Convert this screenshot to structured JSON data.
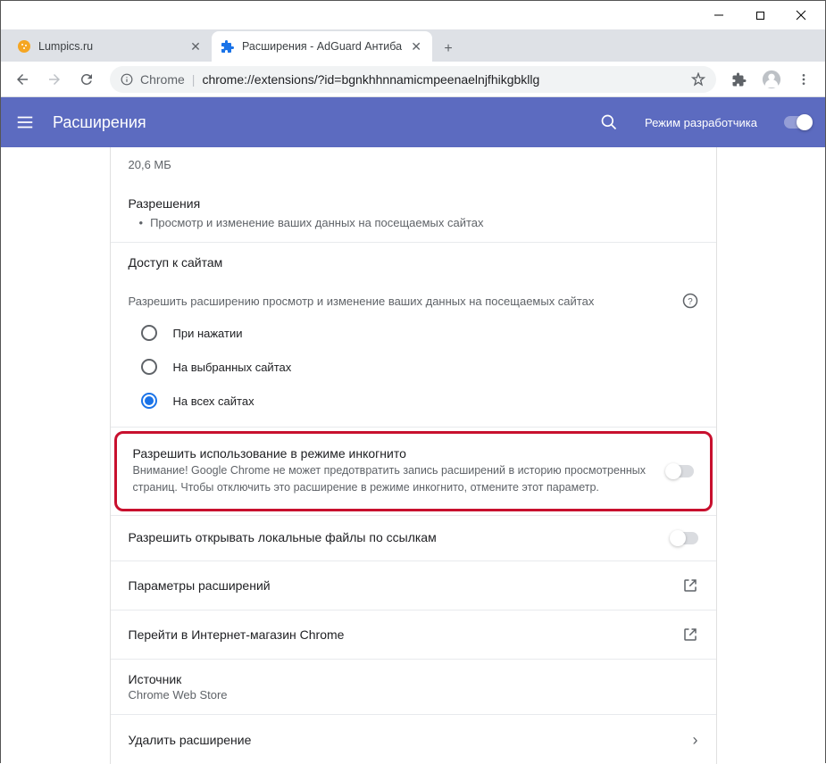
{
  "window": {
    "tabs": [
      {
        "title": "Lumpics.ru",
        "active": false
      },
      {
        "title": "Расширения - AdGuard Антиба",
        "active": true
      }
    ]
  },
  "addressbar": {
    "prefix": "Chrome",
    "url_prefix": "chrome://",
    "url_bold": "extensions",
    "url_rest": "/?id=bgnkhhnnamicmpeenaelnjfhikgbkllg"
  },
  "header": {
    "title": "Расширения",
    "devmode_label": "Режим разработчика"
  },
  "detail": {
    "size": "20,6 МБ",
    "permissions_title": "Разрешения",
    "permissions_item": "Просмотр и изменение ваших данных на посещаемых сайтах",
    "site_access_title": "Доступ к сайтам",
    "site_access_sub": "Разрешить расширению просмотр и изменение ваших данных на посещаемых сайтах",
    "radio_options": [
      "При нажатии",
      "На выбранных сайтах",
      "На всех сайтах"
    ],
    "radio_selected_index": 2,
    "incognito_title": "Разрешить использование в режиме инкогнито",
    "incognito_desc": "Внимание! Google Chrome не может предотвратить запись расширений в историю просмотренных страниц. Чтобы отключить это расширение в режиме инкогнито, отмените этот параметр.",
    "file_urls_title": "Разрешить открывать локальные файлы по ссылкам",
    "options_title": "Параметры расширений",
    "webstore_title": "Перейти в Интернет-магазин Chrome",
    "source_title": "Источник",
    "source_value": "Chrome Web Store",
    "remove_title": "Удалить расширение"
  }
}
